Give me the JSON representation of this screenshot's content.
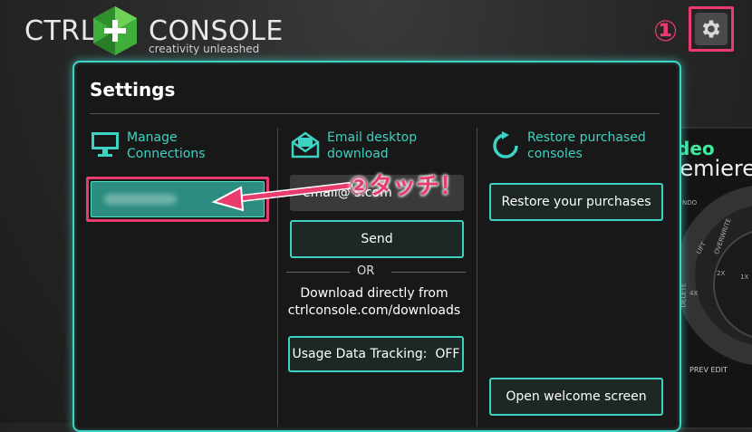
{
  "logo": {
    "left": "CTRL",
    "right": "CONSOLE",
    "tagline": "creativity unleashed",
    "icon": "plus-hexagon-logo"
  },
  "settings_icon": "gear-icon",
  "annotations": {
    "step1": "①",
    "step2": "②タッチ！",
    "color": "#e83c6e"
  },
  "background_panel": {
    "title_partial": "deo",
    "subtitle_partial": "remiere",
    "labels": [
      "NDO",
      "LIFT",
      "OVERWRITE",
      "DELETE",
      "4X",
      "2X",
      "1X"
    ],
    "prev_edit": "PREV EDIT"
  },
  "modal": {
    "title": "Settings",
    "accent": "#3ed2c2",
    "columns": {
      "connections": {
        "icon": "monitor-icon",
        "label_line1": "Manage",
        "label_line2": "Connections"
      },
      "email": {
        "icon": "envelope-icon",
        "label_line1": "Email desktop",
        "label_line2": "download",
        "email_value": "email@     s.com",
        "send_label": "Send",
        "or_label": "OR",
        "download_line1": "Download directly from",
        "download_line2": "ctrlconsole.com/downloads",
        "tracking_label": "Usage Data Tracking:  OFF"
      },
      "restore": {
        "icon": "refresh-icon",
        "label_line1": "Restore purchased",
        "label_line2": "consoles",
        "restore_label": "Restore your purchases",
        "welcome_label": "Open welcome screen"
      }
    }
  }
}
